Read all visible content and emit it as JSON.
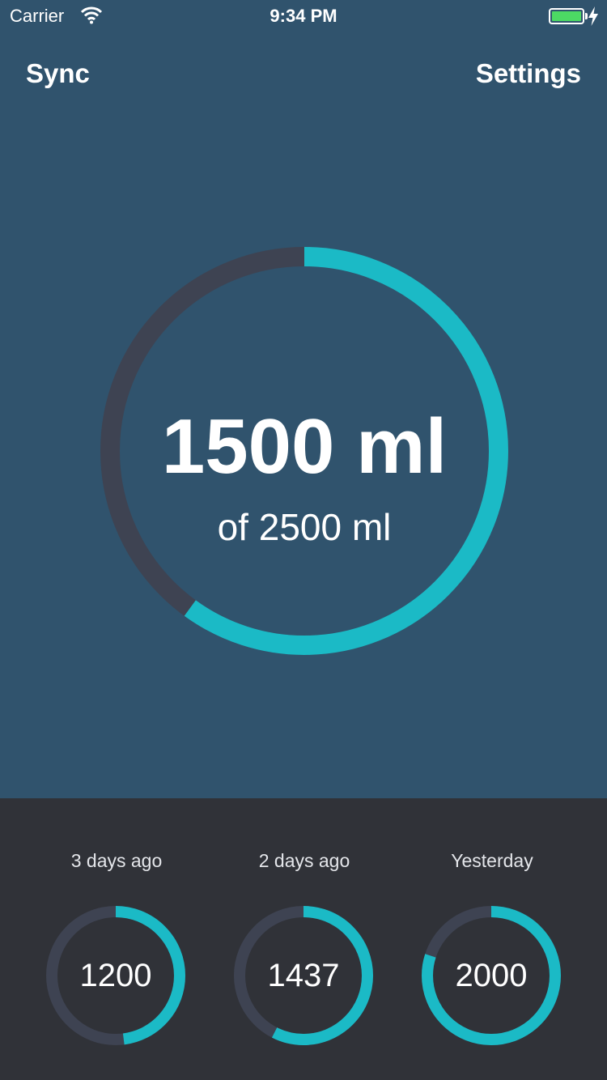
{
  "status_bar": {
    "carrier": "Carrier",
    "time": "9:34 PM",
    "battery_level": 1.0
  },
  "nav": {
    "sync_label": "Sync",
    "settings_label": "Settings"
  },
  "today": {
    "value_text": "1500 ml",
    "goal_text": "of 2500 ml",
    "amount": 1500,
    "goal": 2500
  },
  "history": [
    {
      "label": "3 days ago",
      "value_text": "1200",
      "amount": 1200
    },
    {
      "label": "2 days ago",
      "value_text": "1437",
      "amount": 1437
    },
    {
      "label": "Yesterday",
      "value_text": "2000",
      "amount": 2000
    }
  ],
  "colors": {
    "background": "#30536D",
    "panel": "#303238",
    "progress": "#1BBAC6",
    "track": "#3E4352",
    "battery": "#4CD964"
  }
}
